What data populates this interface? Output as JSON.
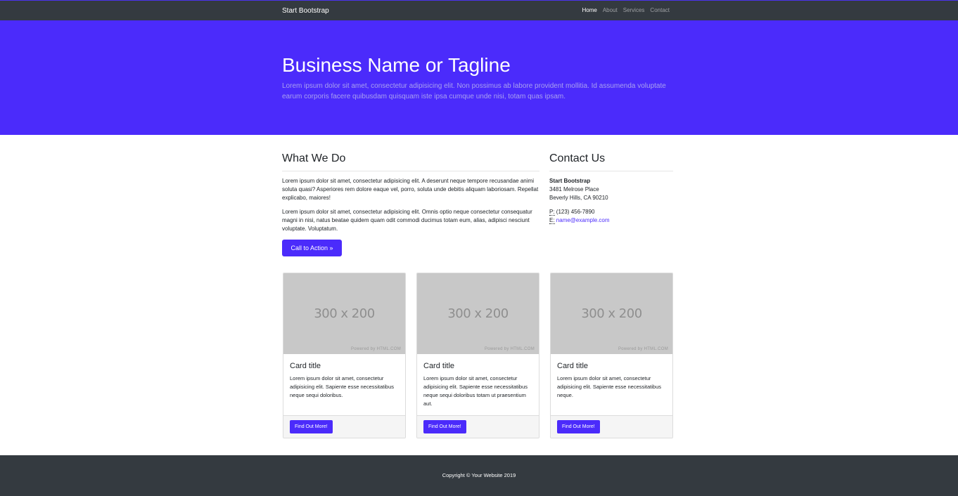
{
  "navbar": {
    "brand": "Start Bootstrap",
    "links": [
      {
        "label": "Home"
      },
      {
        "label": "About"
      },
      {
        "label": "Services"
      },
      {
        "label": "Contact"
      }
    ]
  },
  "hero": {
    "title": "Business Name or Tagline",
    "text": "Lorem ipsum dolor sit amet, consectetur adipisicing elit. Non possimus ab labore provident mollitia. Id assumenda voluptate earum corporis facere quibusdam quisquam iste ipsa cumque unde nisi, totam quas ipsam."
  },
  "what_we_do": {
    "heading": "What We Do",
    "paragraphs": [
      "Lorem ipsum dolor sit amet, consectetur adipisicing elit. A deserunt neque tempore recusandae animi soluta quasi? Asperiores rem dolore eaque vel, porro, soluta unde debitis aliquam laboriosam. Repellat explicabo, maiores!",
      "Lorem ipsum dolor sit amet, consectetur adipisicing elit. Omnis optio neque consectetur consequatur magni in nisi, natus beatae quidem quam odit commodi ducimus totam eum, alias, adipisci nesciunt voluptate. Voluptatum."
    ],
    "cta_label": "Call to Action »"
  },
  "contact": {
    "heading": "Contact Us",
    "name": "Start Bootstrap",
    "address_line1": "3481 Melrose Place",
    "address_line2": "Beverly Hills, CA 90210",
    "phone_abbr": "P:",
    "phone": "(123) 456-7890",
    "email_abbr": "E:",
    "email": "name@example.com"
  },
  "cards": [
    {
      "image_label": "300 x 200",
      "powered": "Powered by HTML.COM",
      "title": "Card title",
      "text": "Lorem ipsum dolor sit amet, consectetur adipisicing elit. Sapiente esse necessitatibus neque sequi doloribus.",
      "button": "Find Out More!"
    },
    {
      "image_label": "300 x 200",
      "powered": "Powered by HTML.COM",
      "title": "Card title",
      "text": "Lorem ipsum dolor sit amet, consectetur adipisicing elit. Sapiente esse necessitatibus neque sequi doloribus totam ut praesentium aut.",
      "button": "Find Out More!"
    },
    {
      "image_label": "300 x 200",
      "powered": "Powered by HTML.COM",
      "title": "Card title",
      "text": "Lorem ipsum dolor sit amet, consectetur adipisicing elit. Sapiente esse necessitatibus neque.",
      "button": "Find Out More!"
    }
  ],
  "footer": {
    "copyright": "Copyright © Your Website 2019"
  },
  "colors": {
    "primary": "#4b2bfb",
    "dark": "#343a40"
  }
}
